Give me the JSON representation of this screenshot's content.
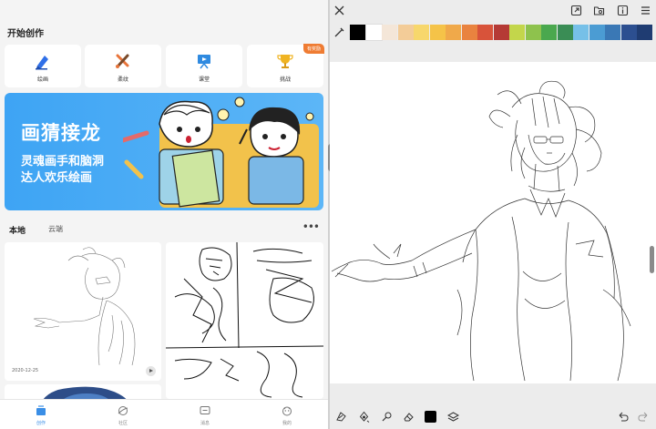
{
  "home": {
    "section_title": "开始创作",
    "tools": [
      {
        "label": "绘画",
        "icon": "pencil-icon"
      },
      {
        "label": "柔纹",
        "icon": "brushes-icon"
      },
      {
        "label": "课堂",
        "icon": "classroom-icon"
      },
      {
        "label": "挑战",
        "icon": "trophy-icon",
        "badge": "有奖励"
      }
    ],
    "banner": {
      "title": "画猜接龙",
      "subtitle_line1": "灵魂画手和脑洞",
      "subtitle_line2": "达人欢乐绘画"
    },
    "tabs": {
      "local": "本地",
      "cloud": "云端",
      "more": "•••"
    },
    "artworks": [
      {
        "date": "2020-12-25"
      }
    ],
    "nav": [
      {
        "label": "创作",
        "icon": "create-icon",
        "active": true
      },
      {
        "label": "社区",
        "icon": "community-icon",
        "active": false
      },
      {
        "label": "消息",
        "icon": "message-icon",
        "active": false
      },
      {
        "label": "我的",
        "icon": "profile-icon",
        "active": false
      }
    ]
  },
  "editor": {
    "topbar_icons": [
      "close-icon",
      "export-icon",
      "folder-icon",
      "info-icon",
      "menu-icon"
    ],
    "palette": [
      "#000000",
      "#ffffff",
      "#f4e6d8",
      "#f3cc98",
      "#f7d76c",
      "#f5c348",
      "#f0a94a",
      "#e9833f",
      "#d8533a",
      "#b53a35",
      "#c3d64b",
      "#8ec24d",
      "#4aa84e",
      "#3a8d55",
      "#76c0e8",
      "#4b9cd3",
      "#3a78b5",
      "#2c4f90",
      "#1f3c72"
    ],
    "bottom_icons": [
      "brush-tool-icon",
      "fill-tool-icon",
      "picker-tool-icon",
      "eraser-tool-icon",
      "color-swatch-icon",
      "layers-icon",
      "undo-icon",
      "redo-icon"
    ]
  }
}
